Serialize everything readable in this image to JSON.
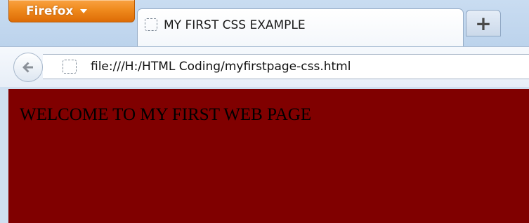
{
  "browser": {
    "menu_button_label": "Firefox",
    "new_tab_label": "+",
    "tab": {
      "title": "MY FIRST CSS EXAMPLE"
    },
    "address_bar": {
      "url": "file:///H:/HTML Coding/myfirstpage-css.html"
    },
    "icons": {
      "menu_dropdown": "chevron-down-icon",
      "tab_favicon": "default-page-icon",
      "back": "back-arrow-icon",
      "site_identity": "default-page-icon"
    }
  },
  "page": {
    "heading": "WELCOME TO MY FIRST WEB PAGE",
    "background_color": "#800000",
    "text_color": "#000000"
  }
}
